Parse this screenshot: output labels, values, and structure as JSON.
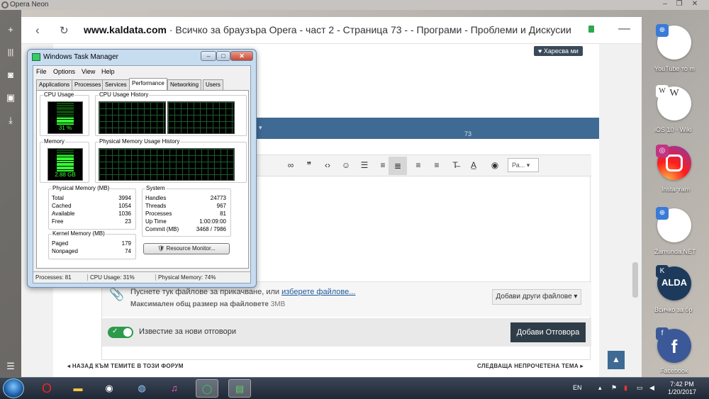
{
  "window": {
    "title": "Opera Neon"
  },
  "browser": {
    "url_domain": "www.kaldata.com",
    "url_rest": " · Всичко за браузъра Opera - част 2 - Страница 73 - - Програми - Проблеми и Дискусии",
    "sidebar_icons": [
      "plus-icon",
      "tabs-icon",
      "camera-icon",
      "gallery-icon",
      "download-icon",
      "menu-icon"
    ]
  },
  "webpage": {
    "like_label": "Харесва ми",
    "pagination_fragment": "73",
    "editor_font_select": "Ра...",
    "attach_text": "Пуснете тук файлове за прикачване, или",
    "attach_link": "изберете файлове...",
    "max_size_label": "Максимален общ размер на файловете",
    "max_size_value": "3MB",
    "add_files_button": "Добави други файлове",
    "notify_label": "Известие за нови отговори",
    "reply_button": "Добави Отговора",
    "back_link": "НАЗАД КЪМ ТЕМИТЕ В ТОЗИ ФОРУМ",
    "next_link": "СЛЕДВАЩА НЕПРОЧЕТЕНА ТЕМА"
  },
  "task_manager": {
    "title": "Windows Task Manager",
    "menu": [
      "File",
      "Options",
      "View",
      "Help"
    ],
    "tabs": [
      "Applications",
      "Processes",
      "Services",
      "Performance",
      "Networking",
      "Users"
    ],
    "selected_tab": "Performance",
    "cpu_usage_label": "CPU Usage",
    "cpu_usage_value": "31 %",
    "cpu_history_label": "CPU Usage History",
    "memory_label": "Memory",
    "memory_value": "2.88 GB",
    "memory_history_label": "Physical Memory Usage History",
    "physical_memory": {
      "label": "Physical Memory (MB)",
      "rows": [
        {
          "k": "Total",
          "v": "3994"
        },
        {
          "k": "Cached",
          "v": "1054"
        },
        {
          "k": "Available",
          "v": "1036"
        },
        {
          "k": "Free",
          "v": "23"
        }
      ]
    },
    "kernel_memory": {
      "label": "Kernel Memory (MB)",
      "rows": [
        {
          "k": "Paged",
          "v": "179"
        },
        {
          "k": "Nonpaged",
          "v": "74"
        }
      ]
    },
    "system": {
      "label": "System",
      "rows": [
        {
          "k": "Handles",
          "v": "24773"
        },
        {
          "k": "Threads",
          "v": "967"
        },
        {
          "k": "Processes",
          "v": "81"
        },
        {
          "k": "Up Time",
          "v": "1:00:09:00"
        },
        {
          "k": "Commit (MB)",
          "v": "3468 / 7986"
        }
      ]
    },
    "resource_monitor_button": "Resource Monitor...",
    "status": {
      "processes": "Processes: 81",
      "cpu": "CPU Usage: 31%",
      "memory": "Physical Memory: 74%"
    },
    "cpu_fill": 0.31,
    "mem_fill": 0.74
  },
  "speed_dial": [
    {
      "label": "YouTube то m",
      "thumb_text": ""
    },
    {
      "label": "iOS 10 - Wiki",
      "thumb_text": "W"
    },
    {
      "label": "Instagram",
      "thumb_text": ""
    },
    {
      "label": "Zamunda.NET",
      "thumb_text": ""
    },
    {
      "label": "Всичко за бр",
      "thumb_text": "ALDA"
    },
    {
      "label": "Facebook",
      "thumb_text": "f"
    }
  ],
  "taskbar": {
    "language": "EN",
    "time": "7:42 PM",
    "date": "1/20/2017"
  },
  "colors": {
    "blue_band": "#3f6a93",
    "reply_button": "#2f3d48",
    "toggle_on": "#2c9a4a",
    "meter_green": "#33ff33"
  }
}
